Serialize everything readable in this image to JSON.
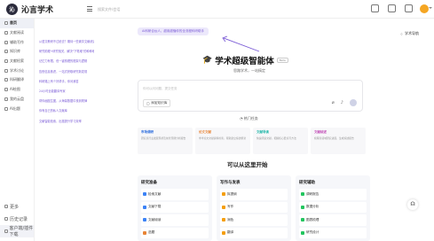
{
  "app": {
    "name": "沁言学术"
  },
  "header": {
    "search_placeholder": "搜索文件/会话"
  },
  "sidebar": {
    "items": [
      {
        "label": "首页",
        "icon": "home-icon"
      },
      {
        "label": "文献阅读",
        "icon": "doc-icon"
      },
      {
        "label": "辅助写作",
        "icon": "pen-icon"
      },
      {
        "label": "知识库",
        "icon": "book-icon"
      },
      {
        "label": "文献检索",
        "icon": "search-icon"
      },
      {
        "label": "学术讨论",
        "icon": "chat-icon"
      },
      {
        "label": "科研翻译",
        "icon": "translate-icon"
      },
      {
        "label": "AI绘图",
        "icon": "image-icon"
      },
      {
        "label": "我的云盘",
        "icon": "cloud-icon"
      },
      {
        "label": "AI出题",
        "icon": "quiz-icon"
      }
    ],
    "bottom": [
      {
        "label": "更多",
        "icon": "more-icon"
      },
      {
        "label": "历史记录",
        "icon": "history-icon"
      },
      {
        "label": "客户端/插件下载",
        "icon": "download-icon"
      }
    ]
  },
  "history": [
    "从语文教研不过瘾去？期待一些爽享文献综述",
    "研究助理+研究相关，解决\"下笔难\"的种种难题",
    "记忆力有限，但一键梳理的框架与逻辑",
    "告别信息焦虑，一站式获取研究新发现",
    "科研路上有个好帮手，你问我答",
    "24小时全能翻译专家",
    "帮你画图生图，从海量数据中找到规律",
    "你有自己的私人文献库",
    "文献智能检索，出题提升学习效率"
  ],
  "main": {
    "chip": "AI科研合伙人，越用越懂你的全流程科研助手",
    "nav_right": "学术导航",
    "title": "学术超级智能体",
    "title_cap": "🎓",
    "beta": "Beta",
    "subtitle": "思路学术，一站搞定",
    "input_placeholder": "你可以问问题、提交任务",
    "attach_label": "添加知识库",
    "hot_label": "热门任务",
    "cards": [
      {
        "title": "市场调研",
        "desc": "研究某行业发展现状及前景预测分析报告",
        "color": "#2f6fde"
      },
      {
        "title": "论文文献",
        "desc": "学术论文文献资料检索，帮助建立综述框架",
        "color": "#e88435"
      },
      {
        "title": "文献导读",
        "desc": "快速阅读文献，把握核心要点与方法",
        "color": "#1eb6a8"
      },
      {
        "title": "文献综述",
        "desc": "梳理某领域研究进展，生成综述报告",
        "color": "#c04ab5"
      }
    ],
    "section_title": "可以从这里开始",
    "panels": [
      {
        "title": "研究准备",
        "items": [
          "检索文献",
          "文献下载",
          "文献阅读",
          "选题"
        ],
        "colors": [
          "#3b82f6",
          "#3b82f6",
          "#3b82f6",
          "#e88435"
        ]
      },
      {
        "title": "写作与发表",
        "items": [
          "拟提纲",
          "写作",
          "润色",
          "翻译"
        ],
        "colors": [
          "#f59e0b",
          "#f59e0b",
          "#f59e0b",
          "#f59e0b"
        ]
      },
      {
        "title": "研究辅助",
        "items": [
          "调研报告",
          "数据分析",
          "图表梳理",
          "研究设计"
        ],
        "colors": [
          "#22c55e",
          "#22c55e",
          "#22c55e",
          "#22c55e"
        ]
      }
    ]
  }
}
